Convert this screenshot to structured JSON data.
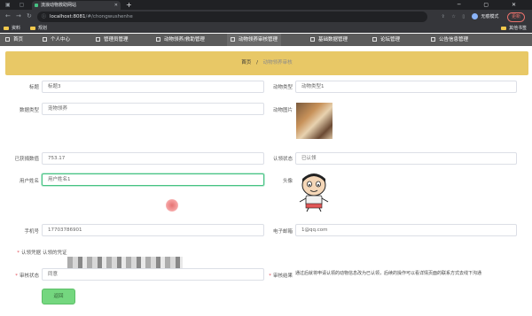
{
  "browser": {
    "tab_title": "流浪动物救助网站",
    "url_host": "localhost:8081",
    "url_path": "/#/chongwushenhe",
    "profile_label": "无痕模式",
    "update_label": "更新",
    "bookmarks": [
      "资料",
      "规划"
    ],
    "bookmarks_right": "其他书签"
  },
  "nav": {
    "items": [
      "首页",
      "个人中心",
      "管理员管理",
      "动物领养/救助管理",
      "动物领养审核管理",
      "基础数据管理",
      "论坛管理",
      "公告信息管理"
    ]
  },
  "breadcrumb": {
    "home": "首页",
    "sep": "/",
    "current": "动物领养审核"
  },
  "form": {
    "title_label": "标题",
    "title_value": "标题3",
    "type_label": "动物类型",
    "type_value": "动物类型1",
    "data_type_label": "数据类型",
    "data_type_value": "宠物领养",
    "image_label": "动物图片",
    "donation_label": "已获捐数值",
    "donation_value": "753.17",
    "cert_status_label": "认领状态",
    "cert_status_value": "已认领",
    "username_label": "用户姓名",
    "username_value": "用户姓名1",
    "avatar_label": "头像",
    "phone_label": "手机号",
    "phone_value": "17703786901",
    "email_label": "电子邮箱",
    "email_value": "1@qq.com",
    "proof_label": "认领凭据",
    "proof_value": "认领的凭证",
    "review_status_label": "审核状态",
    "review_status_value": "同意",
    "review_result_label": "审核结果",
    "review_result_value": "通过后就将申请认领的动物信息改为已认领，后续的操作可以看详情页面的联系方式去线下沟通",
    "back_button": "返回"
  },
  "colors": {
    "banner": "#e8c866",
    "nav_bg": "#5b5b5b",
    "back_button": "#74d77f",
    "focus": "#46c283"
  }
}
